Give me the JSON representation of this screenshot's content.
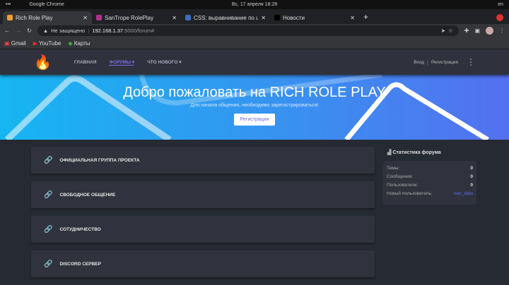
{
  "system": {
    "app": "Google Chrome",
    "datetime": "Вс, 17 апреля  18:28",
    "lang": "en"
  },
  "tabs": [
    {
      "title": "Rich Role Play",
      "color": "#f0a030"
    },
    {
      "title": "SanTrope RolePlay",
      "color": "#b03090"
    },
    {
      "title": "CSS: выравнивание по ц",
      "color": "#3a6fc0"
    },
    {
      "title": "Новости",
      "color": "#000000"
    }
  ],
  "address": {
    "warning": "Не защищено",
    "url_host": "192.168.1.37",
    "url_rest": ":5000/forum#"
  },
  "bookmarks": [
    "Gmail",
    "YouTube",
    "Карты"
  ],
  "nav": {
    "items": [
      "ГЛАВНАЯ",
      "ФОРУМЫ ▾",
      "ЧТО НОВОГО ▾"
    ],
    "login": "Вход",
    "register": "Регистрация"
  },
  "hero": {
    "title": "Добро пожаловать на RICH ROLE PLAY",
    "subtitle": "Для начала общения, необходимо зарегистрироваться!",
    "button": "Регистрация"
  },
  "forums": [
    "ОФИЦИАЛЬНАЯ ГРУППА ПРОЕКТА",
    "СВОБОДНОЕ ОБЩЕНИЕ",
    "СОТУДНИЧЕСТВО",
    "DISCORD СЕРВЕР"
  ],
  "stats": {
    "title": "Статистика форума",
    "rows": [
      {
        "label": "Темы:",
        "value": "0"
      },
      {
        "label": "Сообщения:",
        "value": "0"
      },
      {
        "label": "Пользователи:",
        "value": "0"
      },
      {
        "label": "Новый пользователь:",
        "value": "non_data"
      }
    ]
  }
}
